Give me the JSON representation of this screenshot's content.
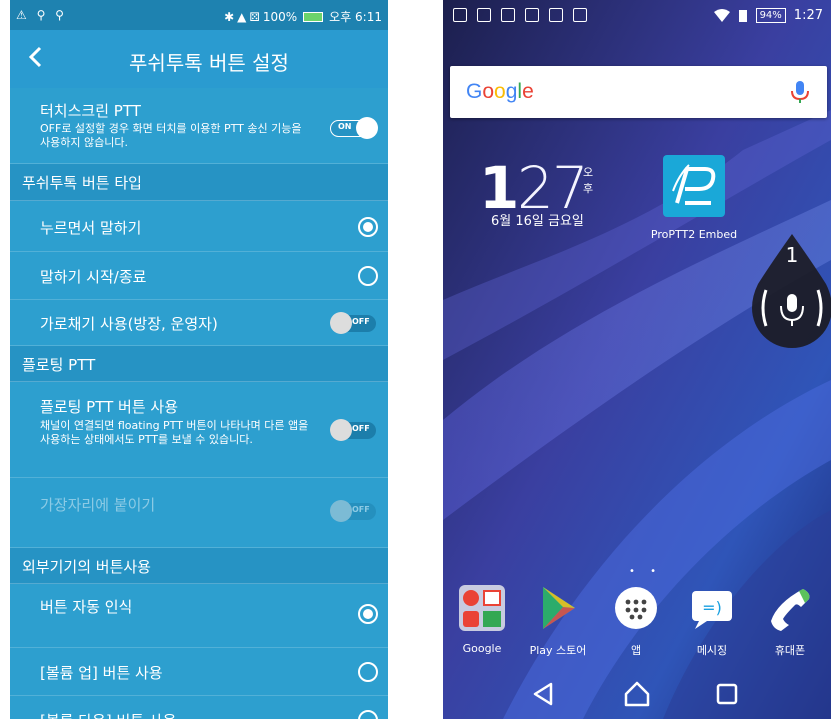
{
  "left": {
    "status": {
      "left_icons": "⚠ ⚲ ⚲",
      "right": [
        "✱",
        "▲",
        "⚄",
        "100%",
        "오후 6:11"
      ]
    },
    "title": "푸쉬투톡 버튼 설정",
    "touch_ptt": {
      "label": "터치스크린 PTT",
      "desc": "OFF로 설정할 경우 화면 터치를 이용한 PTT 송신 기능을 사용하지 않습니다.",
      "toggle": "ON"
    },
    "section_type": "푸쉬투톡 버튼 타입",
    "opt_hold": "누르면서 말하기",
    "opt_startstop": "말하기 시작/종료",
    "opt_intercept": {
      "label": "가로채기 사용(방장, 운영자)",
      "toggle": "OFF"
    },
    "section_floating": "플로팅 PTT",
    "floating_btn": {
      "label": "플로팅 PTT 버튼 사용",
      "desc": "채널이 연결되면 floating PTT 버튼이 나타나며 다른 앱을 사용하는 상태에서도 PTT를 보낼 수 있습니다.",
      "toggle": "OFF"
    },
    "snap_edge": {
      "label": "가장자리에 붙이기",
      "toggle": "OFF"
    },
    "section_external": "외부기기의 버튼사용",
    "auto_detect": "버튼 자동 인식",
    "volume_up": "[볼륨 업] 버튼 사용",
    "volume_down": "[볼륨 다운] 버튼 사용"
  },
  "right": {
    "status": {
      "battery": "94%",
      "time": "1:27"
    },
    "search": {
      "brand": [
        "G",
        "o",
        "o",
        "g",
        "l",
        "e"
      ]
    },
    "clock": {
      "hour": "1",
      "minute": "27",
      "ampm": "오후",
      "date": "6월 16일 금요일"
    },
    "app_widget": "ProPTT2 Embed",
    "float_badge": "1",
    "dock": [
      "Google",
      "Play 스토어",
      "앱",
      "메시징",
      "휴대폰"
    ]
  }
}
